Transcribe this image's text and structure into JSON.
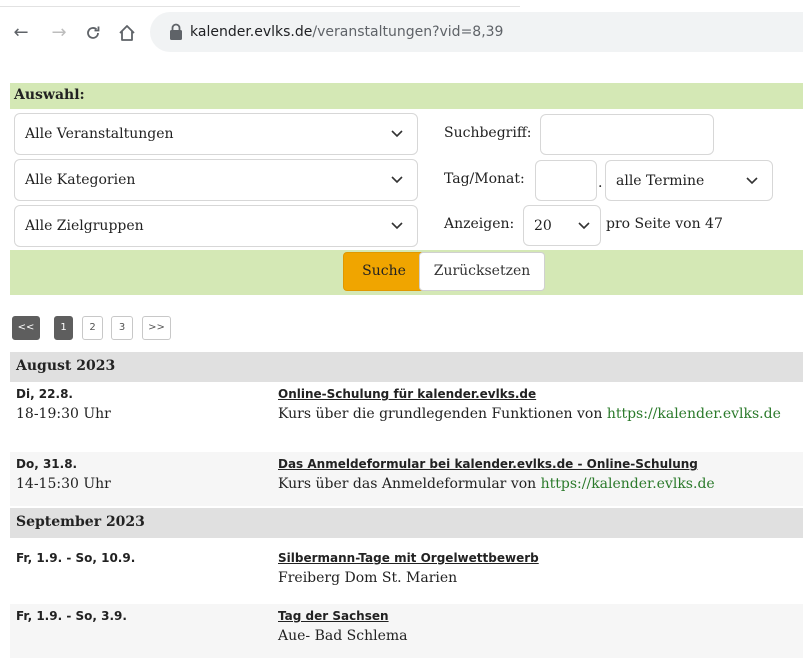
{
  "browser": {
    "back_icon": "arrow-left-icon",
    "forward_icon": "arrow-right-icon",
    "reload_icon": "reload-icon",
    "home_icon": "home-icon",
    "lock_icon": "lock-icon",
    "url_host": "kalender.evlks.de",
    "url_path": "/veranstaltungen?vid=8,39"
  },
  "form": {
    "header": "Auswahl:",
    "select_events": "Alle Veranstaltungen",
    "select_categories": "Alle Kategorien",
    "select_groups": "Alle Zielgruppen",
    "search_label": "Suchbegriff:",
    "search_value": "",
    "date_label": "Tag/Monat:",
    "date_value": "",
    "date_separator": ".",
    "date_range_select": "alle Termine",
    "show_label": "Anzeigen:",
    "show_select": "20",
    "per_page_text": "pro Seite von 47",
    "search_button": "Suche",
    "reset_button": "Zurücksetzen"
  },
  "pagination": {
    "first": "<<",
    "pages": [
      "1",
      "2",
      "3"
    ],
    "last": ">>",
    "current": "1"
  },
  "colors": {
    "form_green": "#d4e8b5",
    "search_button": "#f0a500",
    "link_green": "#2b7a2b",
    "month_gray": "#e0e0e0"
  },
  "events": {
    "month1": "August 2023",
    "e1": {
      "date": "Di, 22.8.",
      "time": "18-19:30 Uhr",
      "title": "Online-Schulung für kalender.evlks.de",
      "desc": "Kurs über die grundlegenden Funktionen von ",
      "link": "https://kalender.evlks.de"
    },
    "e2": {
      "date": "Do, 31.8.",
      "time": "14-15:30 Uhr",
      "title": "Das Anmeldeformular bei kalender.evlks.de - Online-Schulung",
      "desc": "Kurs über das Anmeldeformular von ",
      "link": "https://kalender.evlks.de"
    },
    "month2": "September 2023",
    "e3": {
      "date": "Fr, 1.9. - So, 10.9.",
      "title": "Silbermann-Tage mit Orgelwettbewerb",
      "desc": "Freiberg Dom St. Marien"
    },
    "e4": {
      "date": "Fr, 1.9. - So, 3.9.",
      "title": "Tag der Sachsen",
      "desc": "Aue- Bad Schlema"
    }
  }
}
